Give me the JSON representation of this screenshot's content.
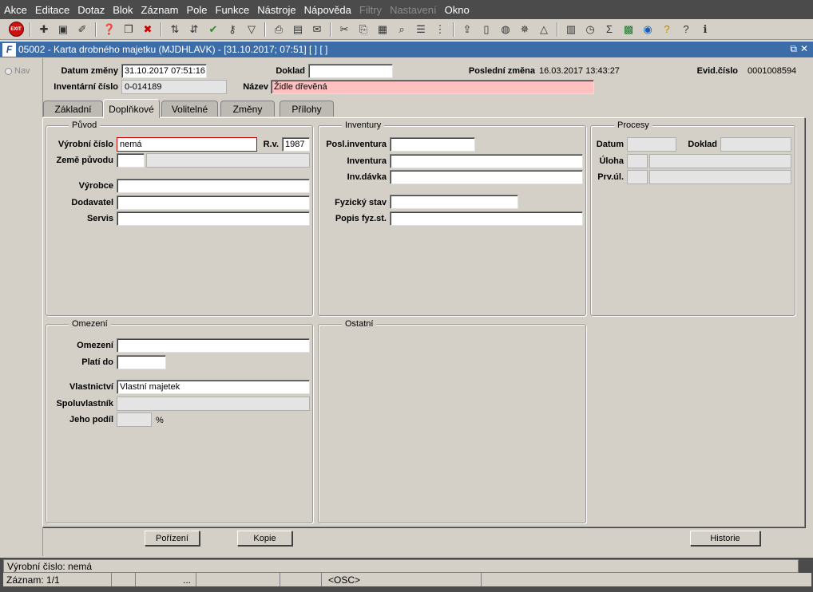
{
  "menu": [
    "Akce",
    "Editace",
    "Dotaz",
    "Blok",
    "Záznam",
    "Pole",
    "Funkce",
    "Nástroje",
    "Nápověda",
    "Filtry",
    "Nastavení",
    "Okno"
  ],
  "menu_disabled": [
    "Filtry",
    "Nastavení"
  ],
  "toolbar": {
    "exit_label": "EXIT",
    "icons": [
      "new-record-icon",
      "save-icon",
      "clear-icon",
      "query-icon",
      "duplicate-icon",
      "delete-icon",
      "sort-asc-icon",
      "sort-desc-icon",
      "check-icon",
      "key-icon",
      "filter-icon",
      "print-icon",
      "print-preview-icon",
      "mail-icon",
      "cut-icon",
      "copy-icon",
      "paste-icon",
      "search-icon",
      "list-icon",
      "tree-icon",
      "export-icon",
      "document-icon",
      "globe-icon",
      "wheel-icon",
      "mountain-icon",
      "chart-icon",
      "clock-icon",
      "sum-icon",
      "excel-icon",
      "web-icon",
      "help-icon",
      "context-help-icon",
      "info-icon"
    ]
  },
  "window": {
    "title": "05002 - Karta drobného majetku (MJDHLAVK) - [31.10.2017; 07:51] [ ] [ ]",
    "icon_letter": "F",
    "ctrl_restore": "⧉",
    "ctrl_close": "✕"
  },
  "nav": {
    "label": "Nav"
  },
  "header": {
    "datum_zmeny_label": "Datum změny",
    "datum_zmeny_value": "31.10.2017 07:51:16",
    "doklad_label": "Doklad",
    "doklad_value": "",
    "posledni_zmena_label": "Poslední změna",
    "posledni_zmena_value": "16.03.2017 13:43:27",
    "evid_cislo_label": "Evid.číslo",
    "evid_cislo_value": "0001008594",
    "inventarni_cislo_label": "Inventární číslo",
    "inventarni_cislo_value": "0-014189",
    "nazev_label": "Název",
    "nazev_value": "Židle dřevěná"
  },
  "tabs": [
    {
      "label": "Základní",
      "active": false
    },
    {
      "label": "Doplňkové",
      "active": true
    },
    {
      "label": "Volitelné",
      "active": false
    },
    {
      "label": "Změny",
      "active": false
    },
    {
      "label": "Přílohy",
      "active": false
    }
  ],
  "puvod": {
    "title": "Původ",
    "vyrobni_cislo_label": "Výrobní číslo",
    "vyrobni_cislo_value": "nemá",
    "rv_label": "R.v.",
    "rv_value": "1987",
    "zeme_puvodu_label": "Země původu",
    "zeme_puvodu_code": "",
    "zeme_puvodu_name": "",
    "vyrobce_label": "Výrobce",
    "vyrobce_value": "",
    "dodavatel_label": "Dodavatel",
    "dodavatel_value": "",
    "servis_label": "Servis",
    "servis_value": ""
  },
  "inventury": {
    "title": "Inventury",
    "posl_inventura_label": "Posl.inventura",
    "posl_inventura_value": "",
    "inventura_label": "Inventura",
    "inventura_value": "",
    "inv_davka_label": "Inv.dávka",
    "inv_davka_value": "",
    "fyzicky_stav_label": "Fyzický stav",
    "fyzicky_stav_value": "",
    "popis_fyz_st_label": "Popis fyz.st.",
    "popis_fyz_st_value": ""
  },
  "procesy": {
    "title": "Procesy",
    "datum_label": "Datum",
    "datum_value": "",
    "doklad_label": "Doklad",
    "doklad_value": "",
    "uloha_label": "Úloha",
    "uloha_code": "",
    "uloha_value": "",
    "prv_ul_label": "Prv.úl.",
    "prv_ul_code": "",
    "prv_ul_value": ""
  },
  "omezeni": {
    "title": "Omezení",
    "omezeni_label": "Omezení",
    "omezeni_value": "",
    "plati_do_label": "Platí do",
    "plati_do_value": "",
    "vlastnictvi_label": "Vlastnictví",
    "vlastnictvi_value": "Vlastní majetek",
    "spoluvlastnik_label": "Spoluvlastník",
    "spoluvlastnik_value": "",
    "jeho_podil_label": "Jeho podíl",
    "jeho_podil_value": "",
    "percent": "%"
  },
  "ostatni": {
    "title": "Ostatní"
  },
  "buttons": {
    "porizeni": "Pořízení",
    "kopie": "Kopie",
    "historie": "Historie"
  },
  "status": {
    "message": "Výrobní číslo: nemá",
    "record": "Záznam: 1/1",
    "ellipsis": "...",
    "mode": "<OSC>"
  }
}
